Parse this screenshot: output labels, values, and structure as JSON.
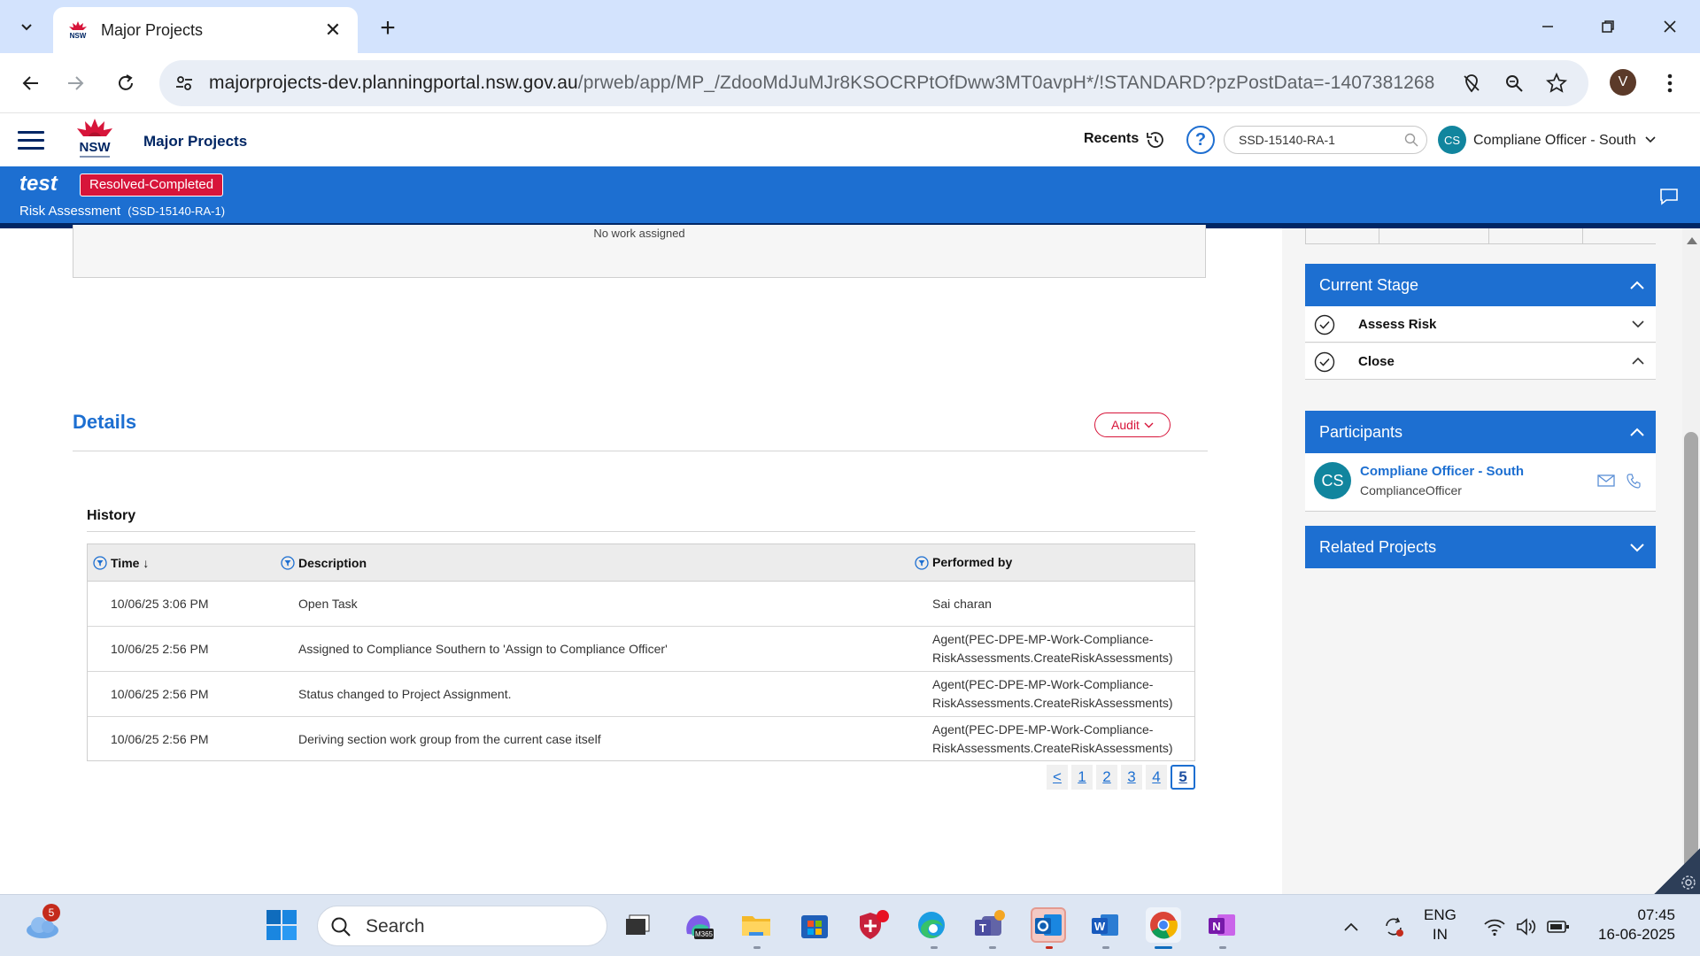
{
  "browser": {
    "tab_title": "Major Projects",
    "tab_close": "✕",
    "new_tab": "+",
    "url_host": "majorprojects-dev.planningportal.nsw.gov.au",
    "url_path": "/prweb/app/MP_/ZdooMdJuMJr8KSOCRPtOfDww3MT0avpH*/!STANDARD?pzPostData=-1407381268",
    "profile_initial": "V"
  },
  "app": {
    "title": "Major Projects",
    "logo_text": "NSW",
    "recents_label": "Recents",
    "help_label": "?",
    "search_value": "SSD-15140-RA-1",
    "user_initials": "CS",
    "user_name": "Compliane Officer - South"
  },
  "case": {
    "title": "test",
    "status": "Resolved-Completed",
    "type": "Risk Assessment",
    "id": "(SSD-15140-RA-1)"
  },
  "work": {
    "empty_text": "No work assigned"
  },
  "details": {
    "title": "Details",
    "audit_label": "Audit",
    "history_title": "History",
    "columns": {
      "time": "Time ↓",
      "description": "Description",
      "performed_by": "Performed by"
    },
    "rows": [
      {
        "time": "10/06/25 3:06 PM",
        "description": "Open Task",
        "performed_by_1": "Sai charan",
        "performed_by_2": ""
      },
      {
        "time": "10/06/25 2:56 PM",
        "description": "Assigned to Compliance Southern to 'Assign to Compliance Officer'",
        "performed_by_1": "Agent(PEC-DPE-MP-Work-Compliance-",
        "performed_by_2": "RiskAssessments.CreateRiskAssessments)"
      },
      {
        "time": "10/06/25 2:56 PM",
        "description": "Status changed to Project Assignment.",
        "performed_by_1": "Agent(PEC-DPE-MP-Work-Compliance-",
        "performed_by_2": "RiskAssessments.CreateRiskAssessments)"
      },
      {
        "time": "10/06/25 2:56 PM",
        "description": "Deriving section work group from the current case itself",
        "performed_by_1": "Agent(PEC-DPE-MP-Work-Compliance-",
        "performed_by_2": "RiskAssessments.CreateRiskAssessments)"
      }
    ],
    "pager": {
      "prev": "<",
      "pages": [
        "1",
        "2",
        "3",
        "4",
        "5"
      ],
      "current": "5"
    }
  },
  "sidebar": {
    "current_stage_title": "Current Stage",
    "stages": [
      {
        "label": "Assess Risk",
        "chevron": "down"
      },
      {
        "label": "Close",
        "chevron": "up"
      }
    ],
    "participants_title": "Participants",
    "participant": {
      "initials": "CS",
      "name": "Compliane Officer - South",
      "role": "ComplianceOfficer"
    },
    "related_title": "Related Projects"
  },
  "taskbar": {
    "weather_badge": "5",
    "search_label": "Search",
    "lang_1": "ENG",
    "lang_2": "IN",
    "time": "07:45",
    "date": "16-06-2025"
  },
  "colors": {
    "brand_blue": "#1d6fd1",
    "nsw_navy": "#002664",
    "status_red": "#d7153a",
    "avatar_teal": "#11859e"
  }
}
